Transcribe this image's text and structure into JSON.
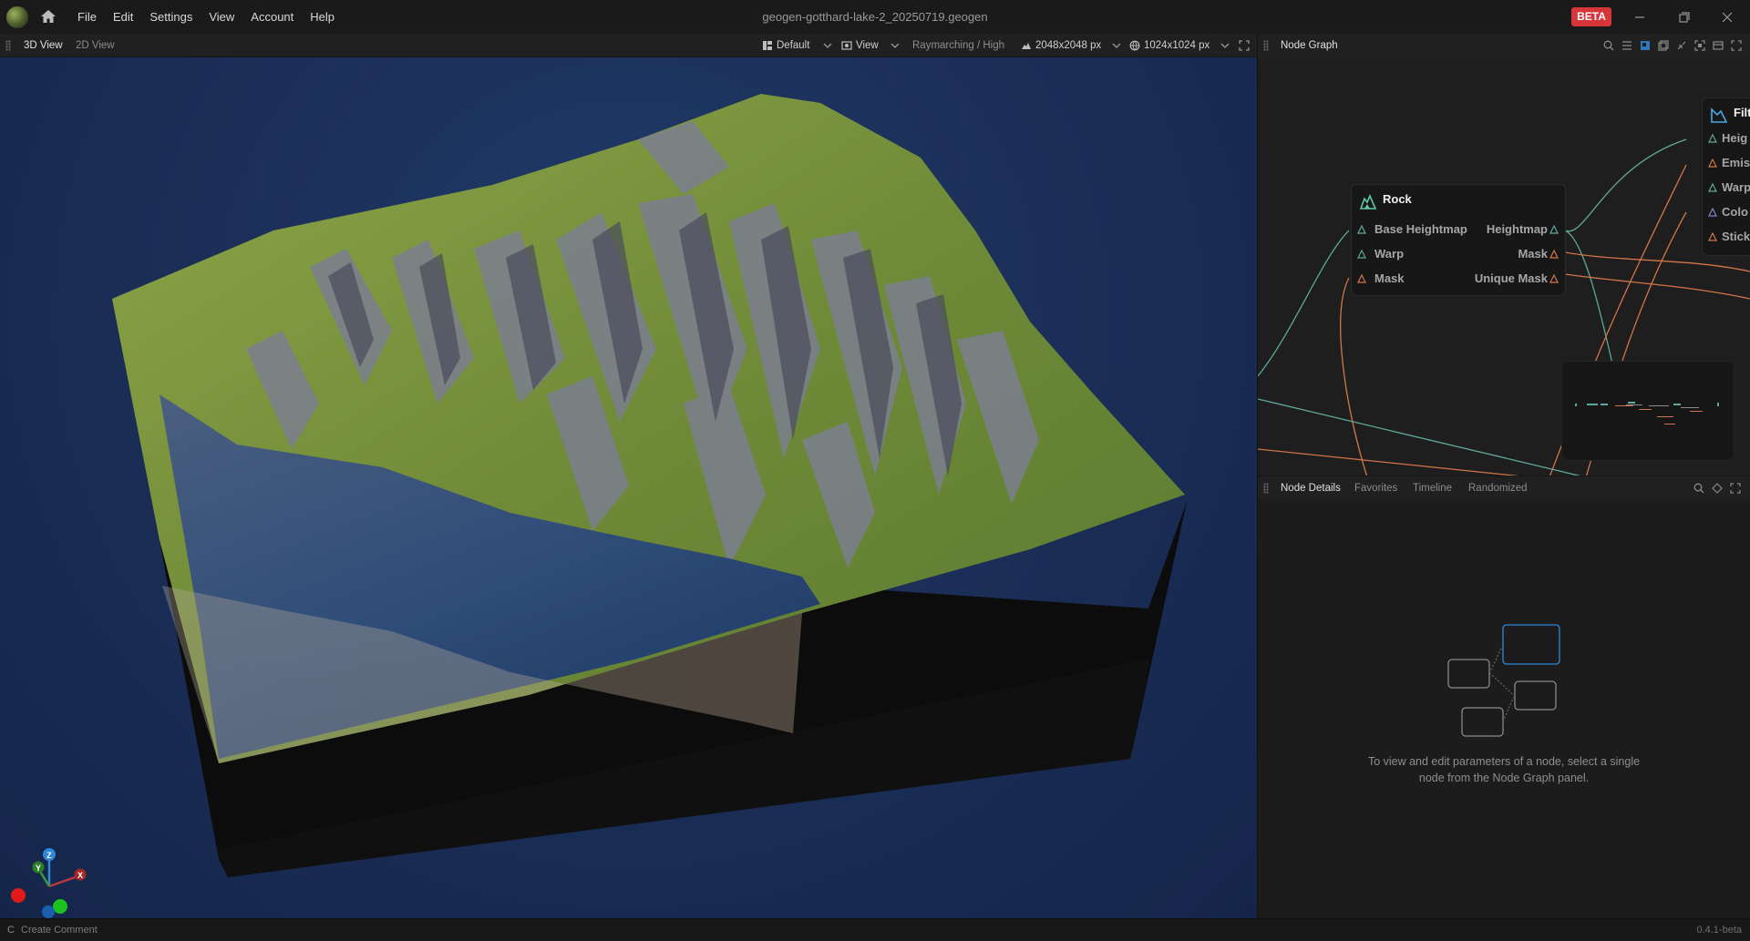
{
  "titlebar": {
    "menu": [
      "File",
      "Edit",
      "Settings",
      "View",
      "Account",
      "Help"
    ],
    "file_title": "geogen-gotthard-lake-2_20250719.geogen",
    "badge": "BETA"
  },
  "viewbar": {
    "tabs": [
      "3D View",
      "2D View"
    ],
    "preset": "Default",
    "view_label": "View",
    "render_mode": "Raymarching / High",
    "resolution": "2048x2048 px",
    "preview_resolution": "1024x1024 px"
  },
  "node_graph": {
    "title": "Node Graph",
    "rock_node": {
      "title": "Rock",
      "inputs": [
        "Base Heightmap",
        "Warp",
        "Mask"
      ],
      "outputs": [
        "Heightmap",
        "Mask",
        "Unique Mask"
      ]
    },
    "filter_node": {
      "title": "Filt",
      "ports": [
        "Heig",
        "Emis",
        "Warp",
        "Colo",
        "Stick"
      ]
    }
  },
  "details": {
    "tabs": [
      "Node Details",
      "Favorites",
      "Timeline",
      "Randomized"
    ],
    "hint": "To view and edit parameters of a node, select a single node from the Node Graph panel."
  },
  "axis_gizmo": {
    "z": "Z",
    "y": "Y",
    "x": "X"
  },
  "statusbar": {
    "shortcut_key": "C",
    "shortcut_label": "Create Comment",
    "version": "0.4.1-beta"
  },
  "colors": {
    "accent_blue": "#2f87d8",
    "beta_red": "#d6363a",
    "port_teal": "#5fa89a",
    "port_orange": "#d27548"
  }
}
